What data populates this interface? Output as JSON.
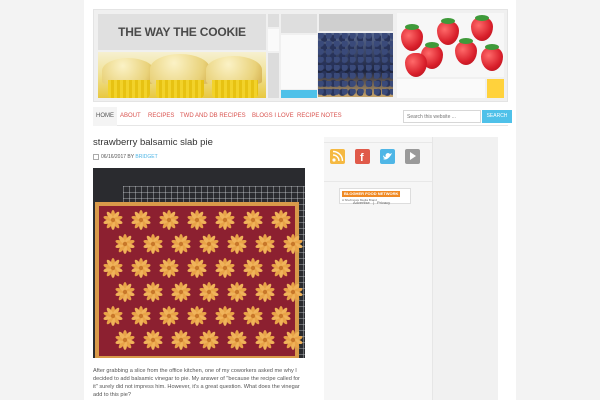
{
  "site": {
    "title": "THE WAY THE COOKIE CRUMBLES"
  },
  "colors": {
    "accent": "#4fc1e9",
    "nav_link": "#d9534f",
    "yellow": "#ffd23c",
    "blue": "#4fc1e9"
  },
  "nav": {
    "items": [
      {
        "label": "HOME",
        "active": true
      },
      {
        "label": "ABOUT"
      },
      {
        "label": "RECIPES"
      },
      {
        "label": "TWD AND DB RECIPES"
      },
      {
        "label": "BLOGS I LOVE"
      },
      {
        "label": "RECIPE NOTES"
      }
    ],
    "search_placeholder": "Search this website ...",
    "search_button": "SEARCH"
  },
  "post": {
    "title": "strawberry balsamic slab pie",
    "date": "06/16/2017",
    "by": "BY",
    "author": "BRIDGET",
    "body": "After grabbing a slice from the office kitchen, one of my coworkers asked me why I decided to add balsamic vinegar to pie. My answer of \"because the recipe called for it\" surely did not impress him. However, it's a great question. What does the vinegar add to this pie?"
  },
  "sidebar": {
    "social": [
      "rss-icon",
      "facebook-icon",
      "twitter-icon",
      "pinterest-icon"
    ],
    "ad": {
      "brand": "BLOGHER FOOD NETWORK",
      "sub": "A SheKnows Media Brand"
    },
    "links": {
      "advertise": "Advertise",
      "privacy": "Privacy"
    }
  }
}
